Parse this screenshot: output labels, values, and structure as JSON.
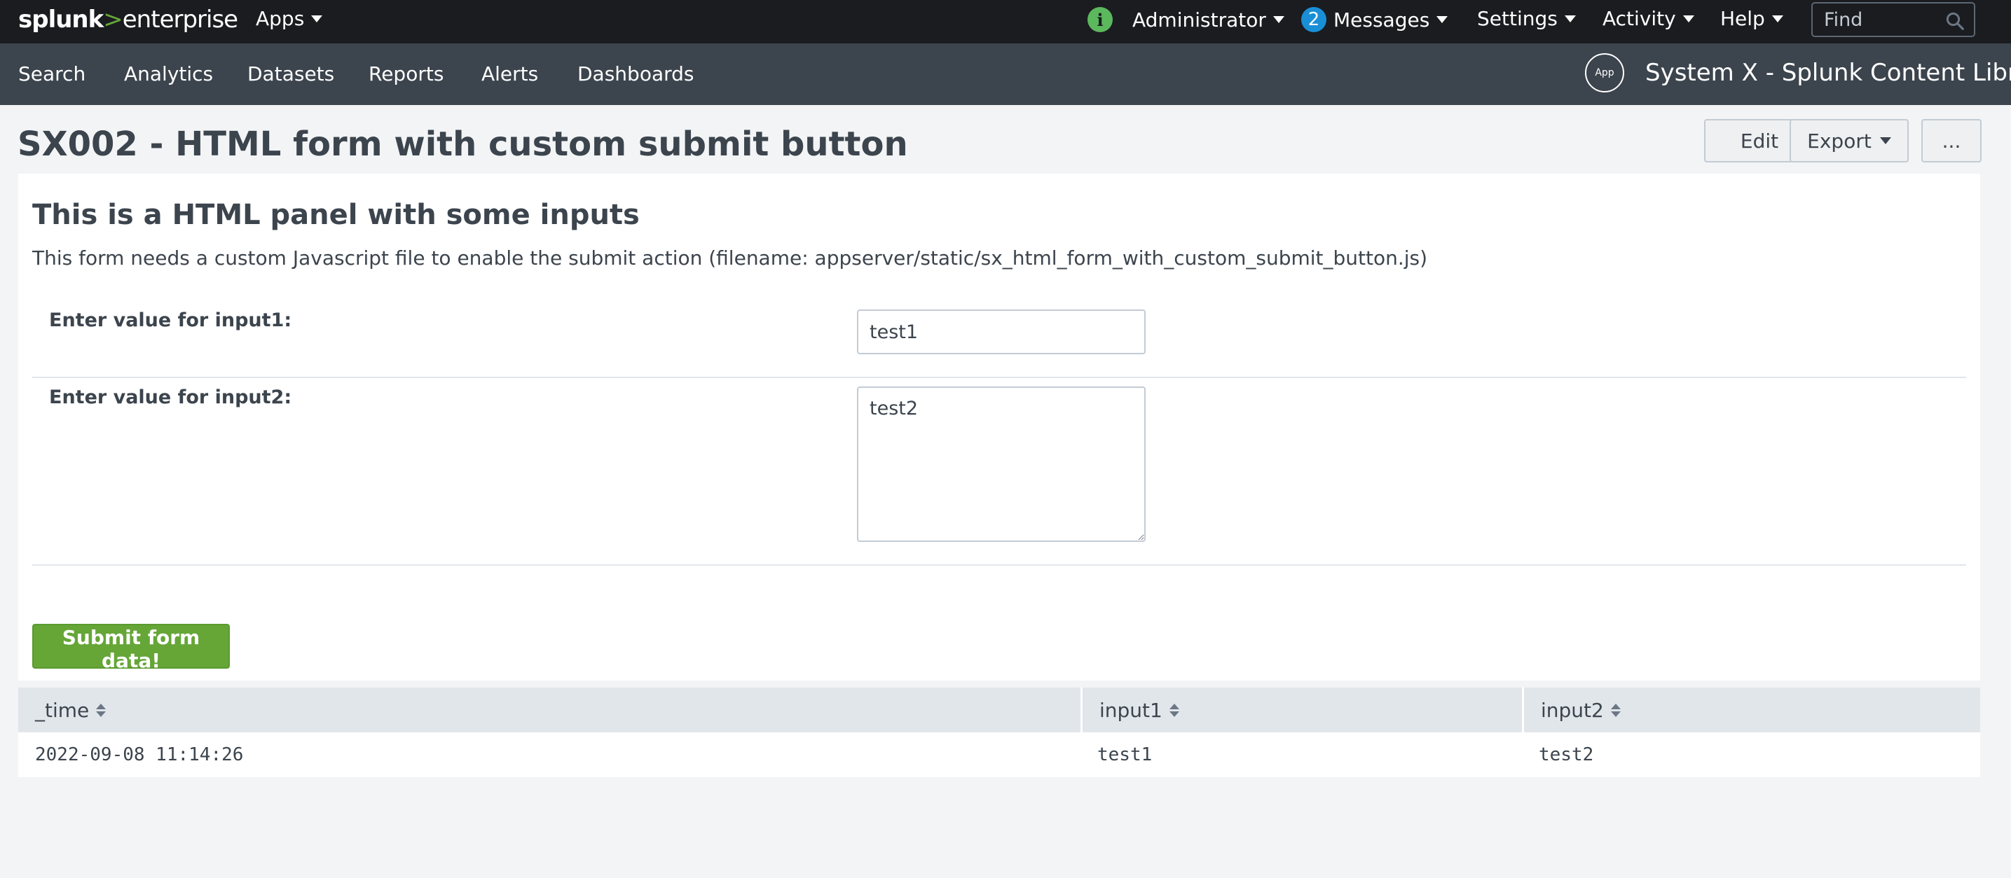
{
  "topbar": {
    "logo": {
      "part1": "splunk",
      "part2": ">",
      "part3": "enterprise"
    },
    "apps_label": "Apps",
    "info_icon_glyph": "i",
    "user_label": "Administrator",
    "messages_count": "2",
    "messages_label": "Messages",
    "settings_label": "Settings",
    "activity_label": "Activity",
    "help_label": "Help",
    "find_placeholder": "Find"
  },
  "appbar": {
    "nav": [
      "Search",
      "Analytics",
      "Datasets",
      "Reports",
      "Alerts",
      "Dashboards"
    ],
    "app_icon_label": "App",
    "app_title": "System X - Splunk Content Library"
  },
  "dashboard": {
    "title": "SX002 - HTML form with custom submit button",
    "edit_label": "Edit",
    "export_label": "Export",
    "more_label": "..."
  },
  "panel": {
    "heading": "This is a HTML panel with some inputs",
    "description": "This form needs a custom Javascript file to enable the submit action (filename: appserver/static/sx_html_form_with_custom_submit_button.js)",
    "input1_label": "Enter value for input1:",
    "input1_value": "test1",
    "input2_label": "Enter value for input2:",
    "input2_value": "test2",
    "submit_label": "Submit form data!"
  },
  "table": {
    "columns": [
      "_time",
      "input1",
      "input2"
    ],
    "rows": [
      [
        "2022-09-08 11:14:26",
        "test1",
        "test2"
      ]
    ]
  },
  "colors": {
    "topbar_bg": "#1a1c20",
    "appbar_bg": "#3c444d",
    "accent_green": "#65a637",
    "badge_blue": "#1a8fd6"
  },
  "icons": {
    "info": "info-icon",
    "search": "search-icon",
    "sort": "sort-icon",
    "caret": "caret-down-icon"
  }
}
